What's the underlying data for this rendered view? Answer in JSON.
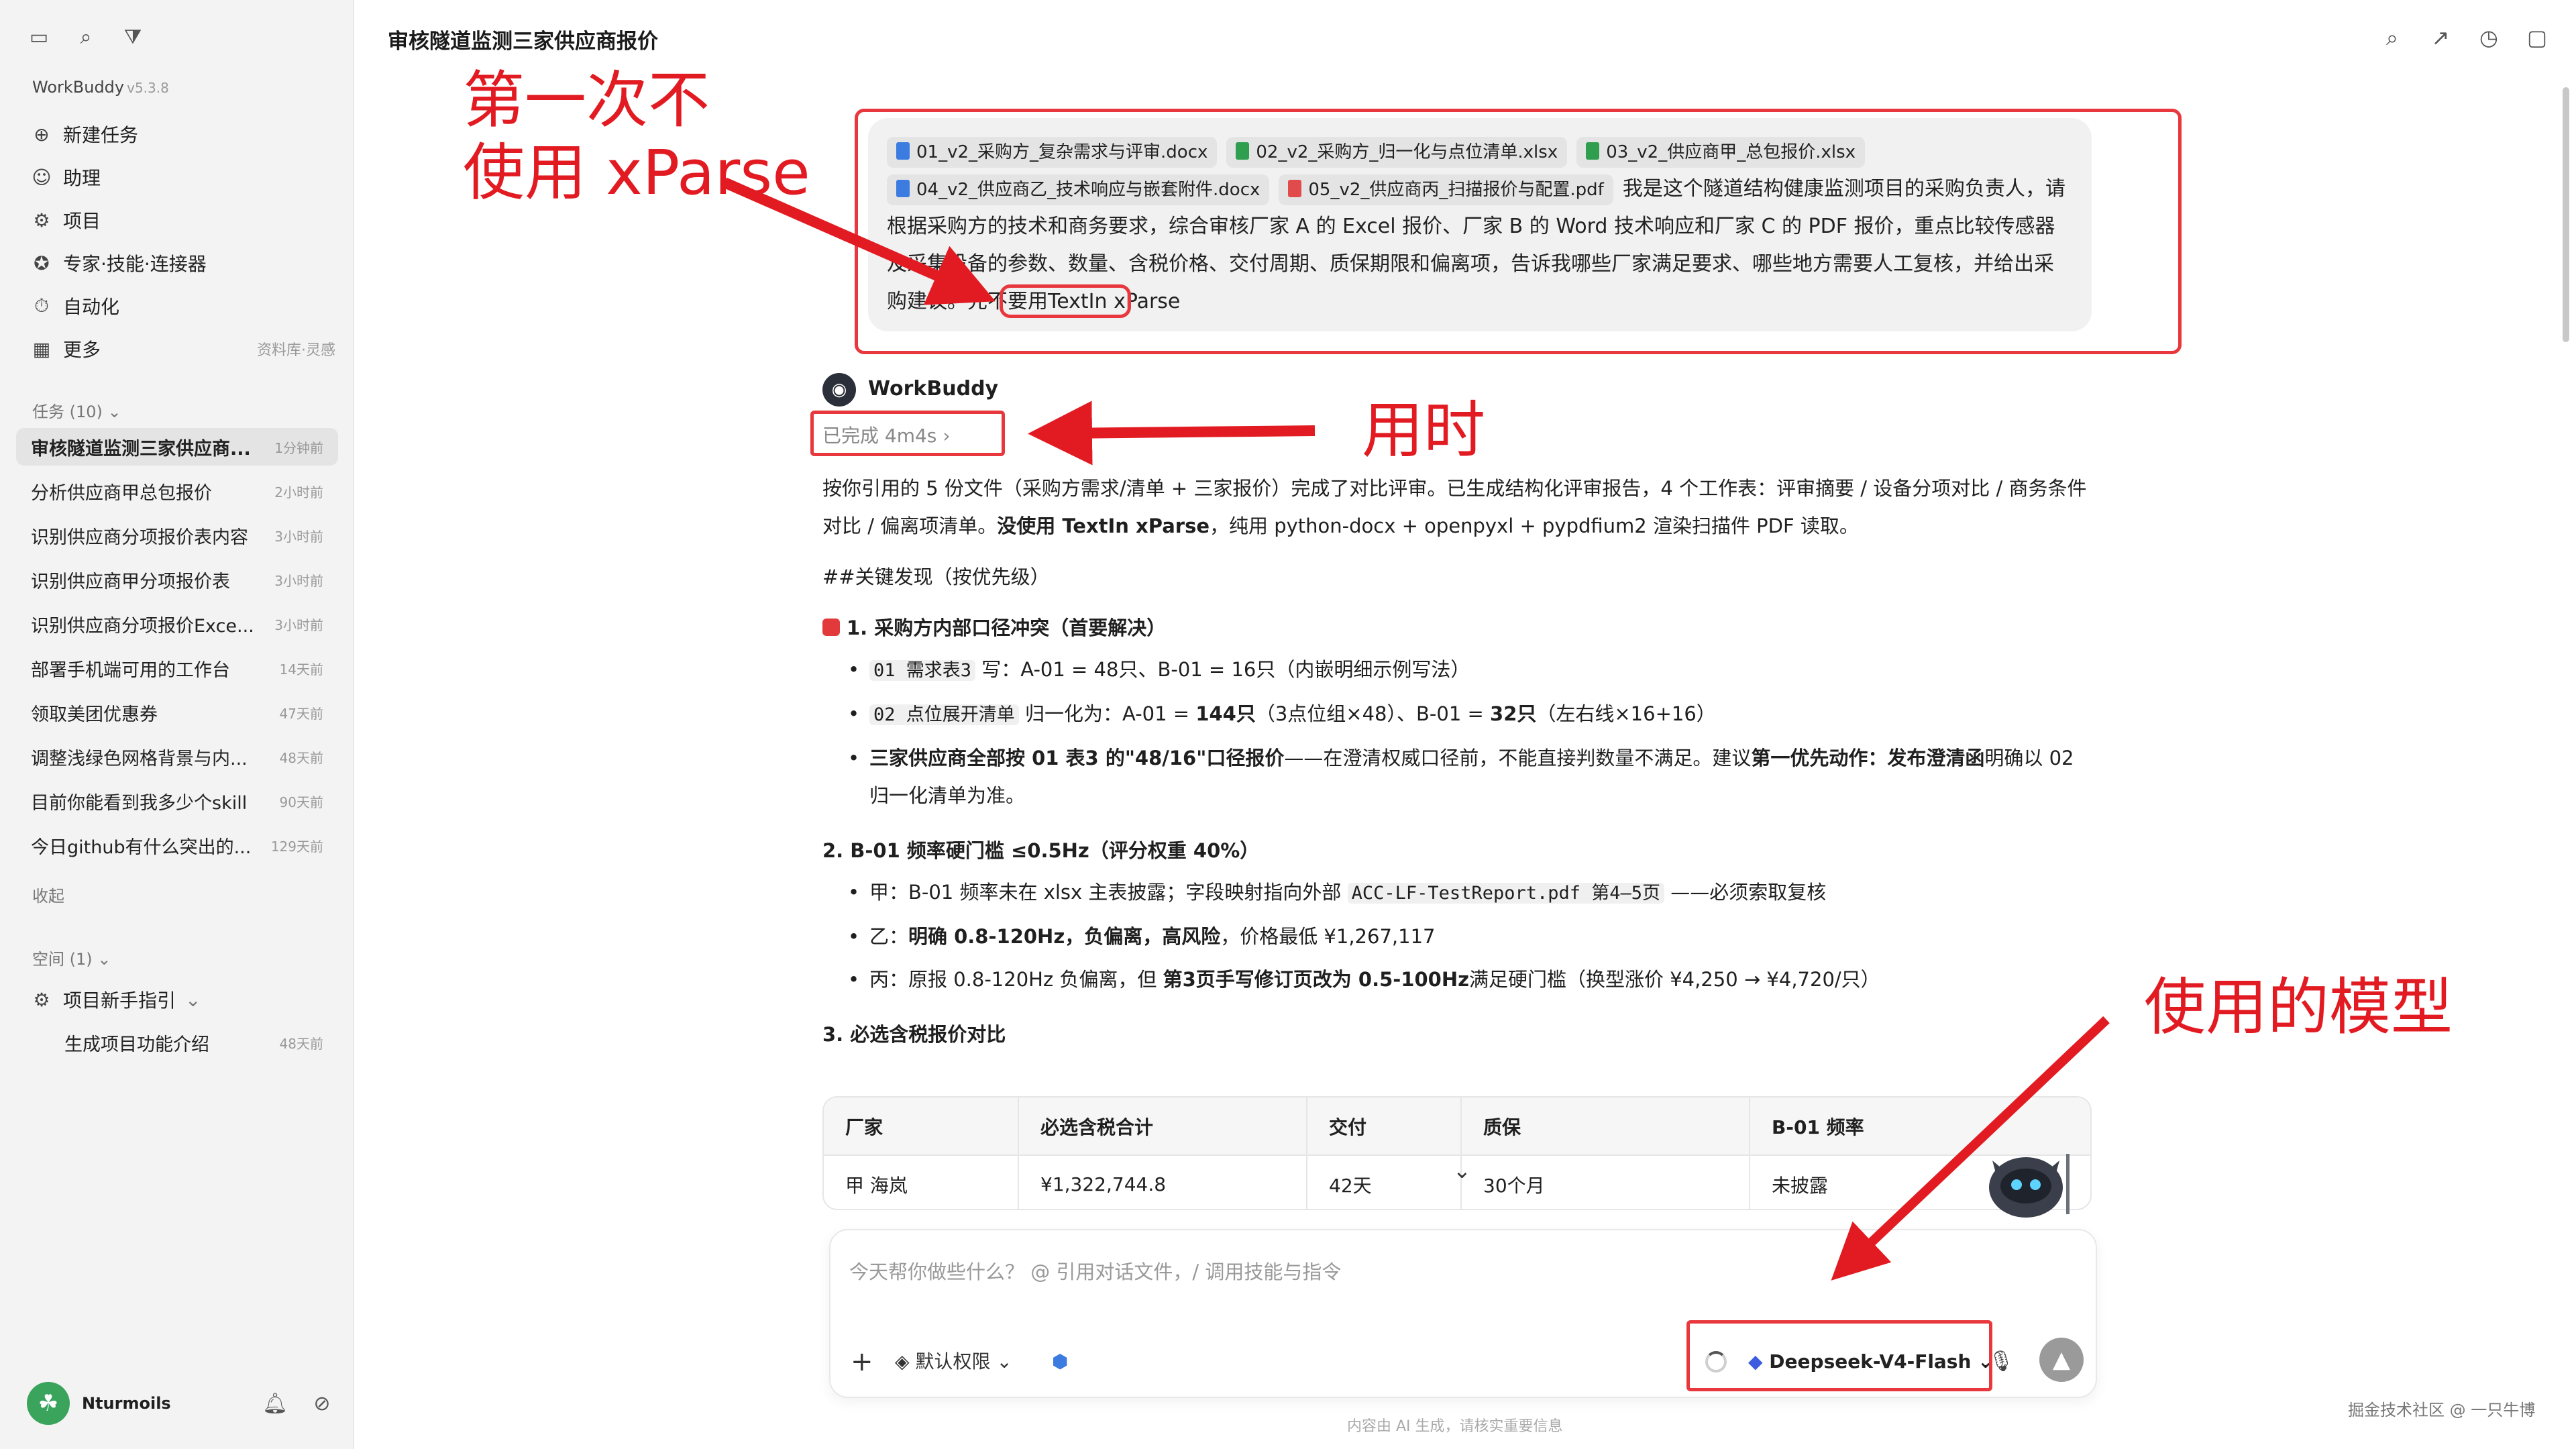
{
  "sidebar": {
    "brand": "WorkBuddy",
    "version": "v5.3.8",
    "nav": [
      {
        "icon": "new-task-icon",
        "glyph": "⊕",
        "label": "新建任务"
      },
      {
        "icon": "assistant-icon",
        "glyph": "☺",
        "label": "助理"
      },
      {
        "icon": "project-icon",
        "glyph": "⚙",
        "label": "项目"
      },
      {
        "icon": "expert-icon",
        "glyph": "✪",
        "label": "专家·技能·连接器"
      },
      {
        "icon": "automation-icon",
        "glyph": "⏱",
        "label": "自动化"
      },
      {
        "icon": "more-icon",
        "glyph": "▦",
        "label": "更多",
        "extra": "资料库·灵感"
      }
    ],
    "tasks_header": "任务 (10)",
    "tasks": [
      {
        "name": "审核隧道监测三家供应商...",
        "time": "1分钟前"
      },
      {
        "name": "分析供应商甲总包报价",
        "time": "2小时前"
      },
      {
        "name": "识别供应商分项报价表内容",
        "time": "3小时前"
      },
      {
        "name": "识别供应商甲分项报价表",
        "time": "3小时前"
      },
      {
        "name": "识别供应商分项报价Exce...",
        "time": "3小时前"
      },
      {
        "name": "部署手机端可用的工作台",
        "time": "14天前"
      },
      {
        "name": "领取美团优惠券",
        "time": "47天前"
      },
      {
        "name": "调整浅绿色网格背景与内...",
        "time": "48天前"
      },
      {
        "name": "目前你能看到我多少个skill",
        "time": "90天前"
      },
      {
        "name": "今日github有什么突出的...",
        "time": "129天前"
      }
    ],
    "collapse": "收起",
    "space_header": "空间 (1)",
    "space_item": "项目新手指引",
    "space_sub": {
      "name": "生成项目功能介绍",
      "time": "48天前"
    },
    "user": "Nturmoils"
  },
  "header": {
    "title": "审核隧道监测三家供应商报价"
  },
  "user_message": {
    "files": [
      {
        "type": "docx",
        "name": "01_v2_采购方_复杂需求与评审.docx"
      },
      {
        "type": "xlsx",
        "name": "02_v2_采购方_归一化与点位清单.xlsx"
      },
      {
        "type": "xlsx",
        "name": "03_v2_供应商甲_总包报价.xlsx"
      },
      {
        "type": "docx",
        "name": "04_v2_供应商乙_技术响应与嵌套附件.docx"
      },
      {
        "type": "pdf",
        "name": "05_v2_供应商丙_扫描报价与配置.pdf"
      }
    ],
    "text": "我是这个隧道结构健康监测项目的采购负责人，请根据采购方的技术和商务要求，综合审核厂家 A 的 Excel 报价、厂家 B 的 Word 技术响应和厂家 C 的 PDF 报价，重点比较传感器及采集设备的参数、数量、含税价格、交付周期、质保期限和偏离项，告诉我哪些厂家满足要求、哪些地方需要人工复核，并给出采购建议。先不要用",
    "tail": "TextIn xParse"
  },
  "assistant": {
    "name": "WorkBuddy",
    "status": "已完成 4m4s",
    "intro_1": "按你引用的 5 份文件（采购方需求/清单 + 三家报价）完成了对比评审。已生成结构化评审报告，4 个工作表：评审摘要 / 设备分项对比 / 商务条件对比 / 偏离项清单。",
    "intro_bold": "没使用 TextIn xParse",
    "intro_2": "，纯用 python-docx + openpyxl + pypdfium2 渲染扫描件 PDF 读取。",
    "key_heading": "##关键发现（按优先级）",
    "s1_title": "1. 采购方内部口径冲突（首要解决）",
    "s1_b1_code": "01 需求表3",
    "s1_b1_text": " 写：A-01 = 48只、B-01 = 16只（内嵌明细示例写法）",
    "s1_b2_code": "02 点位展开清单",
    "s1_b2_text_a": " 归一化为：A-01 = ",
    "s1_b2_bold_a": "144只",
    "s1_b2_text_b": "（3点位组×48）、B-01 = ",
    "s1_b2_bold_b": "32只",
    "s1_b2_text_c": "（左右线×16+16）",
    "s1_b3_bold": "三家供应商全部按 01 表3 的\"48/16\"口径报价",
    "s1_b3_text": "——在澄清权威口径前，不能直接判数量不满足。建议",
    "s1_b3_bold2": "第一优先动作：发布澄清函",
    "s1_b3_text2": "明确以 02 归一化清单为准。",
    "s2_title": "2. B-01 频率硬门槛 ≤0.5Hz（评分权重 40%）",
    "s2_b1_text": "甲：B-01 频率未在 xlsx 主表披露；字段映射指向外部 ",
    "s2_b1_code": "ACC-LF-TestReport.pdf 第4–5页",
    "s2_b1_text2": " ——必须索取复核",
    "s2_b2_text": "乙：",
    "s2_b2_bold": "明确 0.8-120Hz，负偏离，高风险",
    "s2_b2_text2": "，价格最低 ¥1,267,117",
    "s2_b3_text": "丙：原报 0.8-120Hz 负偏离，但 ",
    "s2_b3_bold": "第3页手写修订页改为 0.5-100Hz",
    "s2_b3_text2": "满足硬门槛（换型涨价 ¥4,250 → ¥4,720/只）",
    "s3_title": "3. 必选含税报价对比"
  },
  "table": {
    "headers": [
      "厂家",
      "必选含税合计",
      "交付",
      "质保",
      "B-01 频率"
    ],
    "rows": [
      [
        "甲 海岚",
        "¥1,322,744.8",
        "42天",
        "30个月",
        "未披露"
      ]
    ]
  },
  "composer": {
    "placeholder": "今天帮你做些什么？ @ 引用对话文件，/ 调用技能与指令",
    "add": "+",
    "permission": "默认权限",
    "model": "Deepseek-V4-Flash",
    "disclaimer": "内容由 AI 生成，请核实重要信息"
  },
  "watermark": "掘金技术社区 @ 一只牛博",
  "annotations": {
    "note_1": "第一次不\n使用 xParse",
    "note_2": "用时",
    "note_3": "使用的模型"
  },
  "colors": {
    "annotation": "#e21b22",
    "sidebar_bg": "#f3f3f3"
  }
}
